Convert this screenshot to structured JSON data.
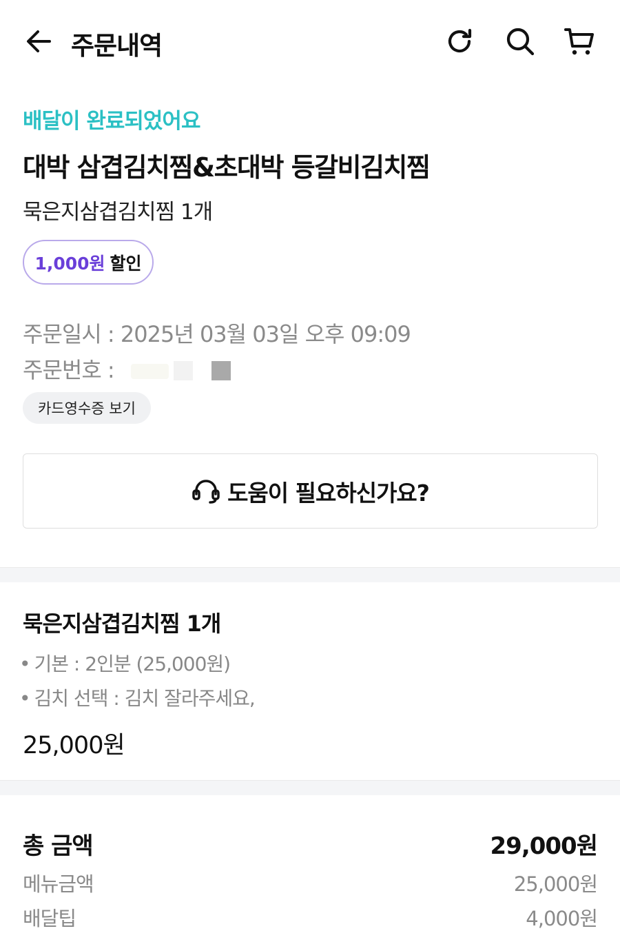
{
  "header": {
    "title": "주문내역",
    "back_icon": "arrow-left-icon",
    "actions": [
      "refresh-icon",
      "search-icon",
      "cart-icon"
    ]
  },
  "order": {
    "status": "배달이 완료되었어요",
    "store_name": "대박 삼겹김치찜&초대박 등갈비김치찜",
    "summary": "묵은지삼겹김치찜 1개",
    "discount_amount": "1,000원",
    "discount_label": "할인",
    "date_label": "주문일시 : ",
    "date_value": "2025년 03월 03일 오후 09:09",
    "number_label": "주문번호 : ",
    "receipt_button": "카드영수증 보기"
  },
  "help": {
    "icon": "headset-icon",
    "label": "도움이 필요하신가요?"
  },
  "menu_item": {
    "title": "묵은지삼겹김치찜 1개",
    "bullet": "•",
    "options": [
      "기본 : 2인분 (25,000원)",
      "김치 선택 : 김치 잘라주세요,"
    ],
    "price": "25,000원"
  },
  "payment": {
    "total_label": "총 금액",
    "total_value": "29,000원",
    "rows": [
      {
        "label": "메뉴금액",
        "value": "25,000원"
      },
      {
        "label": "배달팁",
        "value": "4,000원"
      }
    ]
  },
  "colors": {
    "status": "#2bc0c4",
    "discount": "#6a3fd9",
    "badge_border": "#b9a9ea",
    "muted": "#8a8a8a"
  }
}
